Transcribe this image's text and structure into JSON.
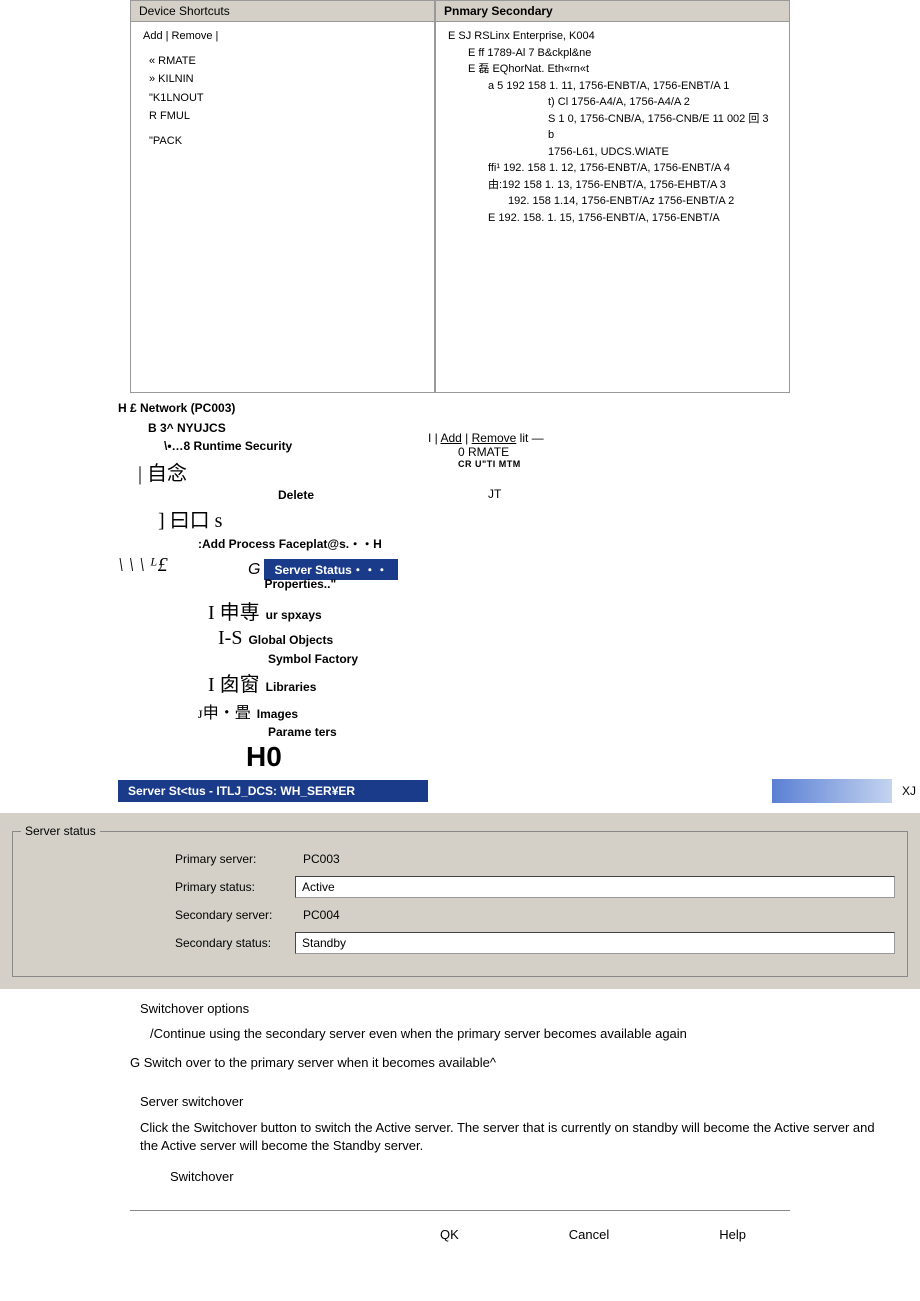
{
  "topLeft": {
    "header": "Device Shortcuts",
    "actions": "Add | Remove |",
    "items": [
      "« RMATE",
      "» KILNIN",
      "\"K1LNOUT",
      "R FMUL",
      "\"PACK"
    ]
  },
  "topRight": {
    "header": "Pnmary Secondary",
    "root": "E SJ RSLinx Enterprise, K004",
    "items": [
      "E  ff 1789-Al 7 B&ckpl&ne",
      "E 磊 EQhorNat. Eth«rn«t",
      "a 5 192 158 1. 11, 1756-ENBT/A, 1756-ENBT/A 1",
      "t) Cl 1756-A4/A, 1756-A4/A 2",
      "S 1 0, 1756-CNB/A, 1756-CNB/E 11 002 回  3 b",
      "1756-L61, UDCS.WIATE",
      "ffi¹ 192. 158 1. 12, 1756-ENBT/A, 1756-ENBT/A 4",
      "由:192 158 1. 13, 1756-ENBT/A, 1756-EHBT/A 3",
      "192. 158 1.14, 1756-ENBT/Aᴢ 1756-ENBT/A 2",
      "E        192. 158. 1. 15, 1756-ENBT/A, 1756-ENBT/A"
    ]
  },
  "midLeft": {
    "netHeader": "H £ Network (PC003)",
    "nyu": "B 3^ NYUJCS",
    "runtime": "\\•…8 Runtime Security",
    "rows": [
      {
        "sym": "| 自念",
        "label": ""
      },
      {
        "sym": "",
        "label": "Delete"
      },
      {
        "sym": "  ]  曰口 s",
        "label": ""
      },
      {
        "sym": "",
        "label": ":Add Process Faceplat@s.・・H"
      },
      {
        "sym": "\\ \\ \\ ᴸ£",
        "label": ""
      },
      {
        "sym": "G",
        "label": "Server Status・・・",
        "highlight": true,
        "props": "Properties..\""
      },
      {
        "sym": "I 申専",
        "label": "ur spxays"
      },
      {
        "sym": "I-S",
        "label": "Global Objects"
      },
      {
        "sym": "",
        "label": "Symbol Factory"
      },
      {
        "sym": "I 囱窗",
        "label": "Libraries"
      },
      {
        "sym": "ᴊ申・畳",
        "label": "Images"
      },
      {
        "sym": "",
        "label": "Parame ters"
      }
    ],
    "h0": "H0"
  },
  "midRight": {
    "addRemove": "I | Add | Remove lit —",
    "rmate": "0 RMATE",
    "cru": "CR U\"TI MTM",
    "jt": "JT"
  },
  "statusBar": {
    "title": "Server St<tus - ITLJ_DCS:   WH_SER¥ER",
    "xj": "XJ"
  },
  "serverStatus": {
    "groupTitle": "Server status",
    "primaryServerLabel": "Primary server:",
    "primaryServer": "PC003",
    "primaryStatusLabel": "Primary status:",
    "primaryStatus": "Active",
    "secondaryServerLabel": "Secondary server:",
    "secondaryServer": "PC004",
    "secondaryStatusLabel": "Secondary status:",
    "secondaryStatus": "Standby"
  },
  "switchover": {
    "optionsHeader": "Switchover options",
    "opt1": "/Continue using the secondary server even when the primary server becomes available again",
    "opt2": "G Switch over to the primary server when it becomes available^",
    "srvHeader": "Server switchover",
    "desc": "Click the Switchover button to switch the Active server. The server that is currently on standby will become the Active server and the Active server will become the Standby server.",
    "btn": "Switchover"
  },
  "buttons": {
    "ok": "QK",
    "cancel": "Cancel",
    "help": "Help"
  }
}
